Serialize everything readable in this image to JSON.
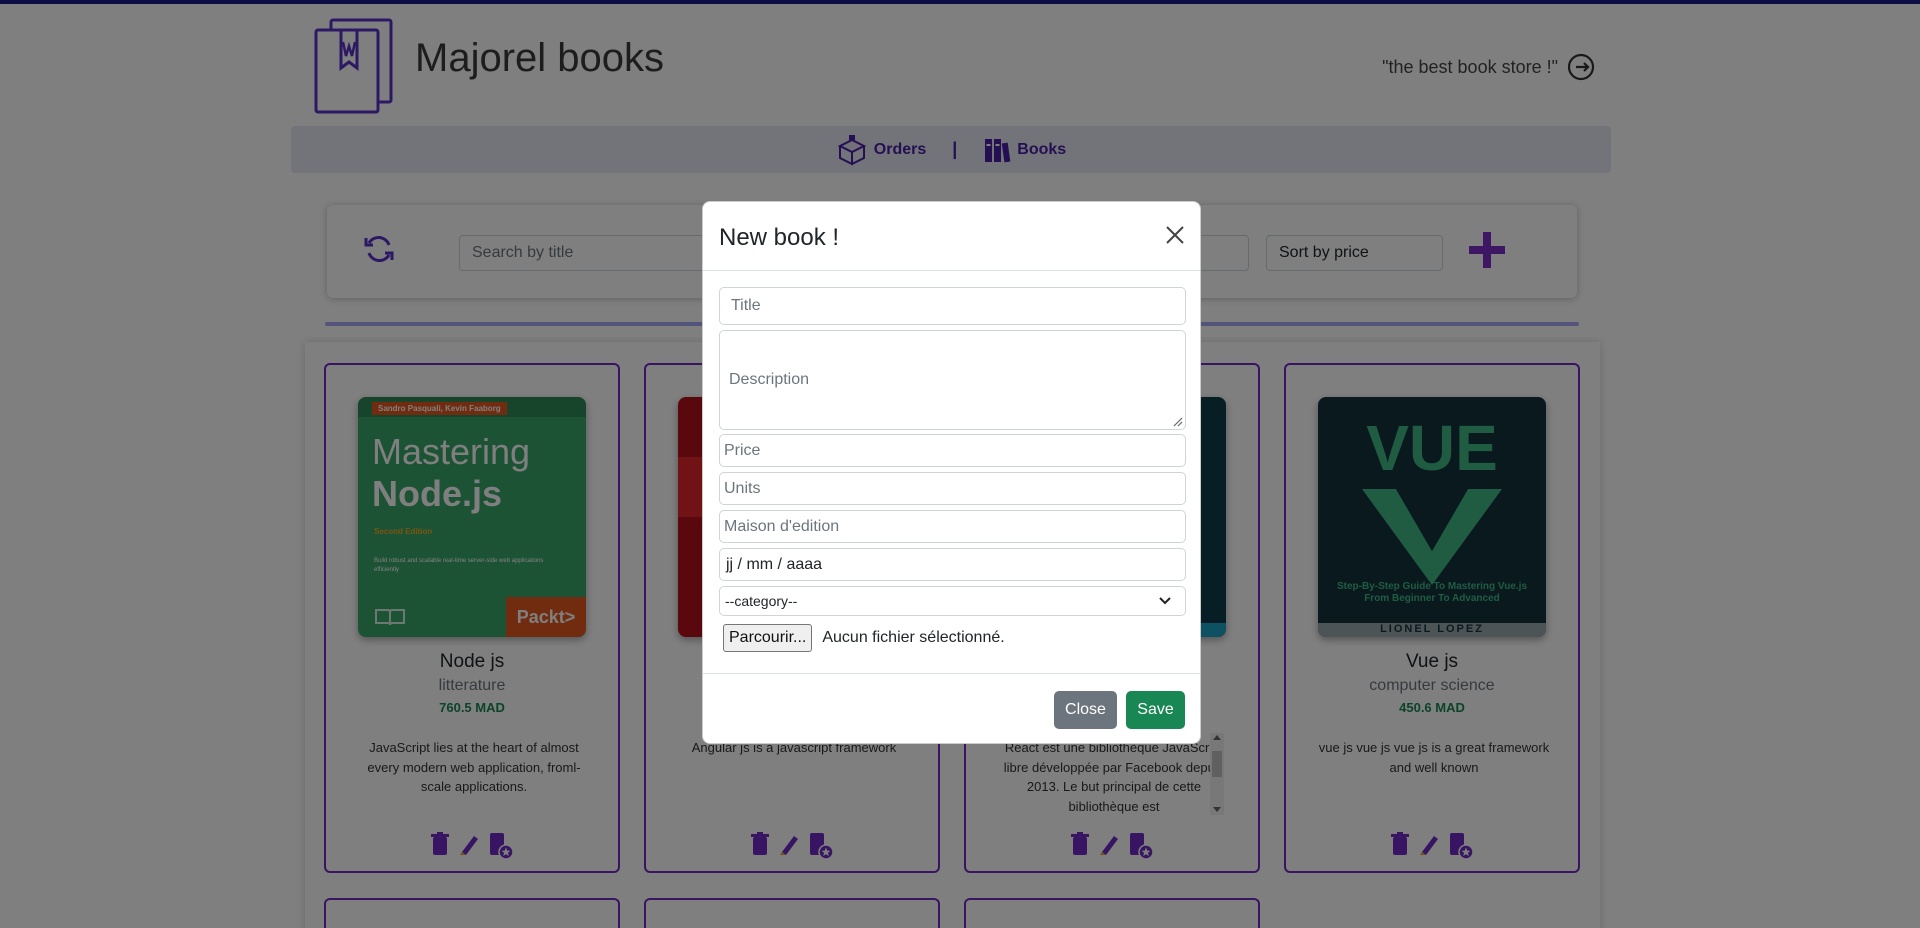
{
  "brand": {
    "title": "Majorel books",
    "tagline": "\"the best book store !\""
  },
  "nav": {
    "items": [
      {
        "label": "Orders"
      },
      {
        "label": "Books"
      }
    ],
    "separator": "|"
  },
  "toolbar": {
    "search_placeholder": "Search by title",
    "sort_label": "Sort by price"
  },
  "books": [
    {
      "title": "Node js",
      "category": "litterature",
      "price": "760.5 MAD",
      "description": "JavaScript lies at the heart of almost every modern web application, froml-scale applications.",
      "cover": {
        "authors": "Sandro Pasquali, Kevin Faaborg",
        "line1": "Mastering",
        "line2": "Node.js",
        "edition": "Second Edition",
        "blurb": "Build robust and scalable real-time server-side web applications efficiently",
        "publisher": "Packt>"
      }
    },
    {
      "title": "",
      "category": "",
      "price": "",
      "description": "Angular js is a javascript framework"
    },
    {
      "title": "",
      "category": "",
      "price": "",
      "description": "React est une bibliothèque JavaScript libre développée par Facebook depuis 2013. Le but principal de cette bibliothèque est"
    },
    {
      "title": "Vue js",
      "category": "computer science",
      "price": "450.6 MAD",
      "description": "vue js vue js vue js is a great framework and well known",
      "cover": {
        "word": "VUE",
        "subtitle": "Step-By-Step Guide To Mastering Vue.js From Beginner To Advanced",
        "author": "LIONEL LOPEZ"
      }
    }
  ],
  "modal": {
    "title": "New book !",
    "fields": {
      "title_placeholder": "Title",
      "description_placeholder": "Description",
      "price_placeholder": "Price",
      "units_placeholder": "Units",
      "publisher_placeholder": "Maison d'edition",
      "date_value": "jj / mm / aaaa",
      "category_value": "--category--",
      "file_button": "Parcourir...",
      "file_status": "Aucun fichier sélectionné."
    },
    "close_label": "Close",
    "save_label": "Save"
  },
  "colors": {
    "accent": "#6f2bc5",
    "nav_text": "#4b1fa6",
    "price": "#198754",
    "save": "#198754",
    "close": "#6c757d"
  }
}
